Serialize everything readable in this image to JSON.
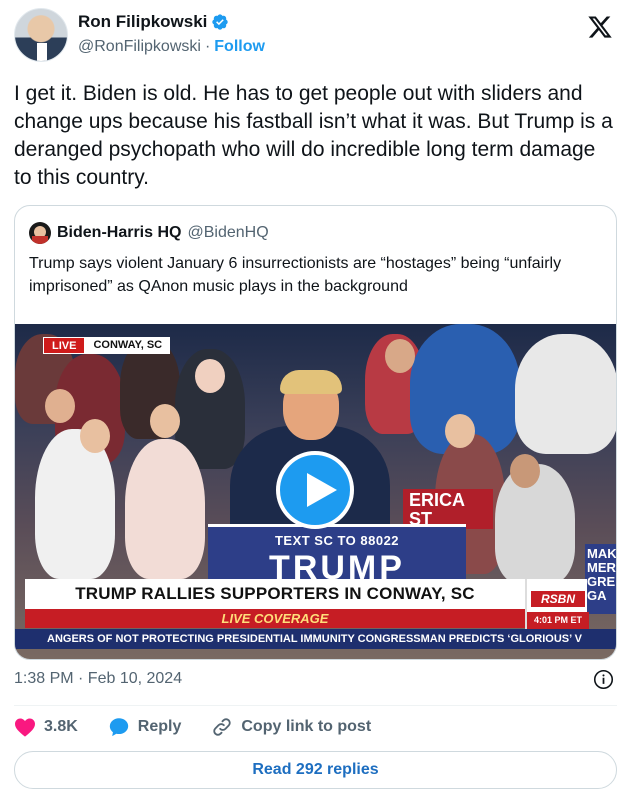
{
  "author": {
    "display_name": "Ron Filipkowski",
    "handle": "@RonFilipkowski",
    "separator": "·",
    "follow_label": "Follow",
    "verified": true
  },
  "tweet": {
    "text": "I get it. Biden is old. He has to get people out with sliders and change ups because his fastball isn’t what it was. But Trump is a deranged psychopath who will do incredible long term damage to this country."
  },
  "quote": {
    "display_name": "Biden-Harris HQ",
    "handle": "@BidenHQ",
    "text": "Trump says violent January 6 insurrectionists are “hostages” being “unfairly imprisoned” as QAnon music plays in the background",
    "video": {
      "live_label": "LIVE",
      "location": "CONWAY, SC",
      "podium_small": "TEXT SC TO 88022",
      "podium_big": "TRUMP",
      "side_sign": "ERICA\nST",
      "far_sign": "MAK\nMER\nGRE\nGA",
      "chyron": "TRUMP RALLIES SUPPORTERS IN CONWAY, SC",
      "coverage": "LIVE COVERAGE",
      "network": "RSBN",
      "time": "4:01 PM ET",
      "ticker": "ANGERS OF NOT PROTECTING PRESIDENTIAL IMMUNITY     CONGRESSMAN PREDICTS ‘GLORIOUS’ V"
    }
  },
  "timestamp": "1:38 PM · Feb 10, 2024",
  "actions": {
    "likes": "3.8K",
    "reply_label": "Reply",
    "copy_label": "Copy link to post"
  },
  "read_replies_label": "Read 292 replies",
  "colors": {
    "accent": "#1d9bf0",
    "like": "#f91880",
    "muted": "#536471"
  }
}
